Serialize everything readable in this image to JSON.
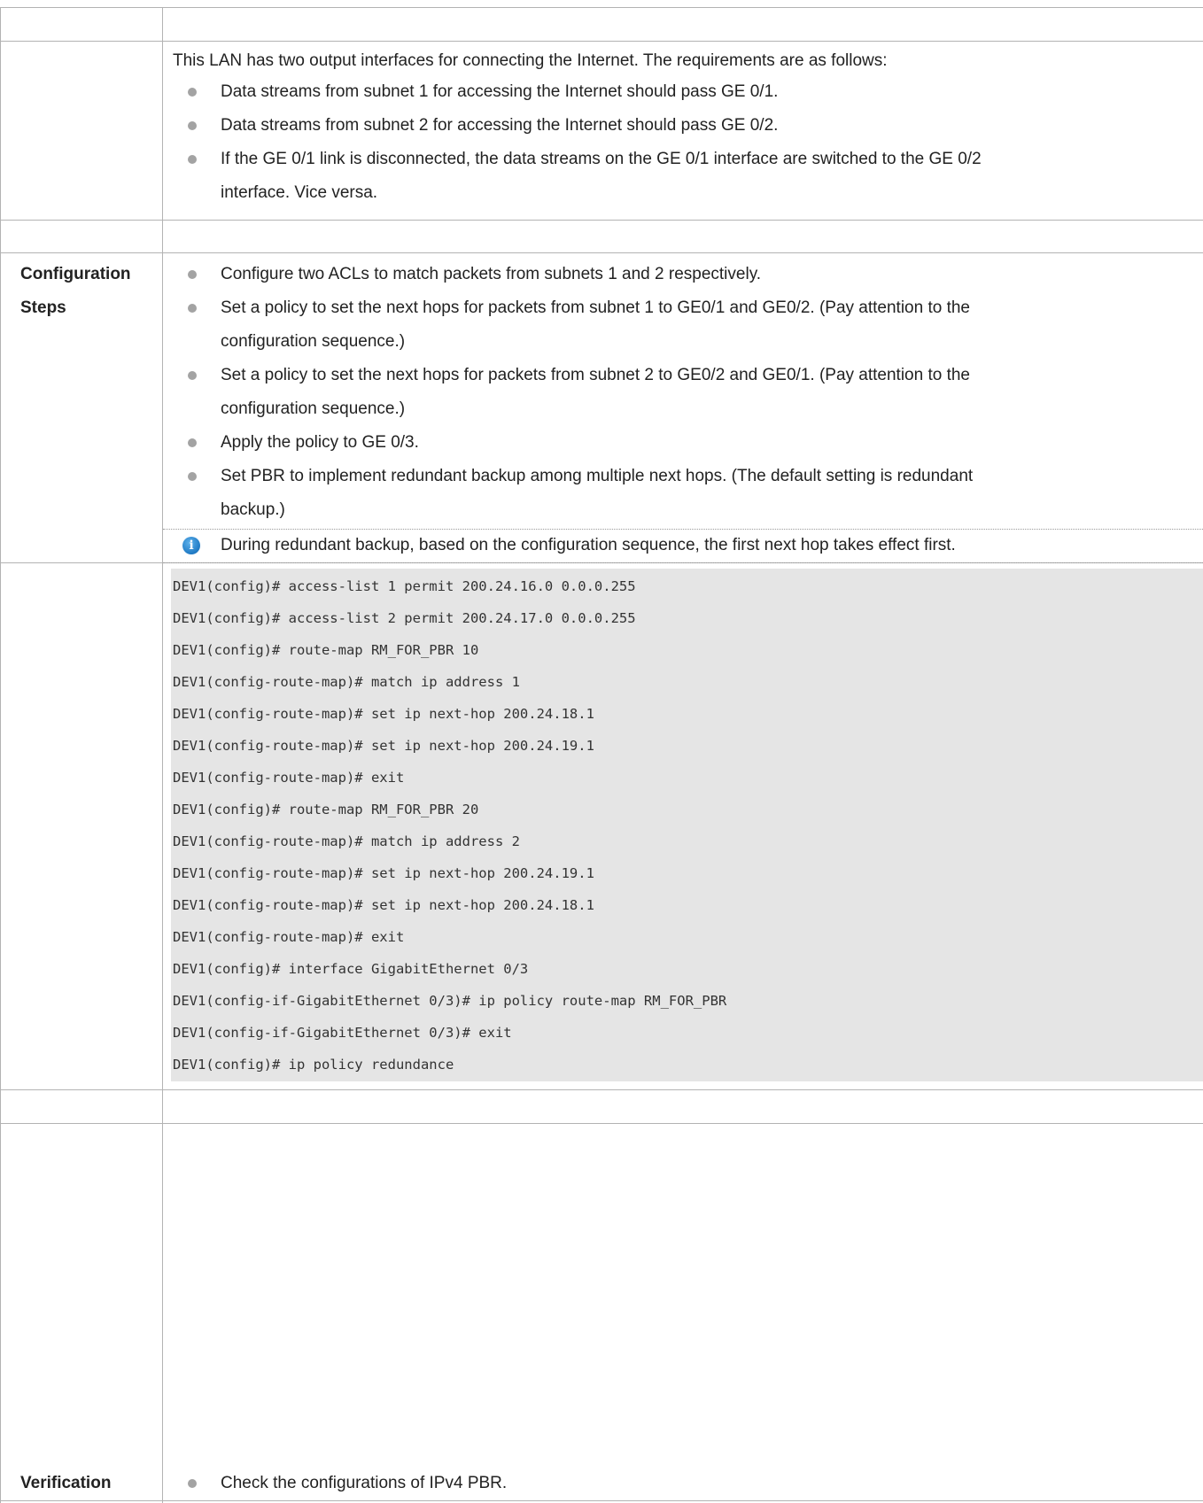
{
  "scenario": {
    "intro": "This LAN has two output interfaces for connecting the Internet. The requirements are as follows:",
    "requirements": [
      "Data streams from subnet 1 for accessing the Internet should pass GE 0/1.",
      "Data streams from subnet 2 for accessing the Internet should pass GE 0/2.",
      "If the GE 0/1 link is disconnected, the data streams on the GE 0/1 interface are switched to the GE 0/2",
      "interface. Vice versa."
    ]
  },
  "configuration_steps": {
    "label_line1": "Configuration",
    "label_line2": "Steps",
    "steps": [
      "Configure two ACLs to match packets from subnets 1 and 2 respectively.",
      "Set a policy to set the next hops for packets from subnet 1 to GE0/1 and GE0/2. (Pay attention to the",
      "configuration sequence.)",
      "Set a policy to set the next hops for packets from subnet 2 to GE0/2 and GE0/1. (Pay attention to the",
      "configuration sequence.)",
      "Apply the policy to GE 0/3.",
      "Set PBR to implement redundant backup among multiple next hops. (The default setting is redundant",
      "backup.)"
    ],
    "note": "During redundant backup, based on the configuration sequence, the first next hop takes effect first.",
    "note_icon": "info-icon"
  },
  "code": [
    "DEV1(config)# access-list 1 permit 200.24.16.0 0.0.0.255",
    "DEV1(config)# access-list 2 permit 200.24.17.0 0.0.0.255",
    "DEV1(config)# route-map RM_FOR_PBR 10",
    "DEV1(config-route-map)# match ip address 1",
    "DEV1(config-route-map)# set ip next-hop 200.24.18.1",
    "DEV1(config-route-map)# set ip next-hop 200.24.19.1",
    "DEV1(config-route-map)# exit",
    "DEV1(config)# route-map RM_FOR_PBR 20",
    "DEV1(config-route-map)# match ip address 2",
    "DEV1(config-route-map)# set ip next-hop 200.24.19.1",
    "DEV1(config-route-map)# set ip next-hop 200.24.18.1",
    "DEV1(config-route-map)# exit",
    "DEV1(config)# interface GigabitEthernet 0/3",
    "DEV1(config-if-GigabitEthernet 0/3)# ip policy route-map RM_FOR_PBR",
    "DEV1(config-if-GigabitEthernet 0/3)# exit",
    "DEV1(config)# ip policy redundance"
  ],
  "verification": {
    "label": "Verification",
    "items": [
      "Check the configurations of IPv4 PBR."
    ]
  },
  "colors": {
    "border": "#b3b3b3",
    "code_bg": "#e5e5e5",
    "bullet": "#a3a3a3",
    "info_icon": "#1f7ac4"
  }
}
